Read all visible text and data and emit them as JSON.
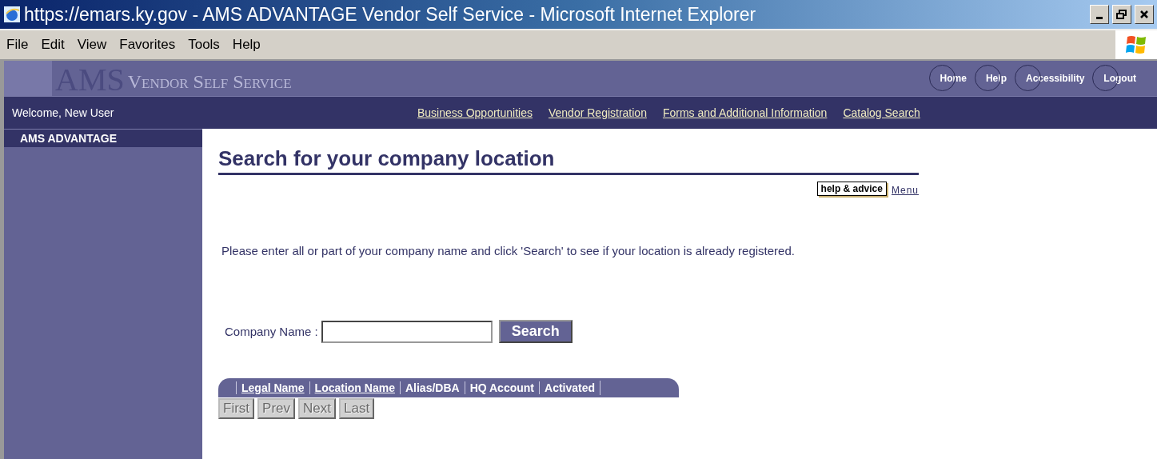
{
  "window": {
    "title": "https://emars.ky.gov - AMS ADVANTAGE Vendor Self Service - Microsoft Internet Explorer"
  },
  "menu": [
    "File",
    "Edit",
    "View",
    "Favorites",
    "Tools",
    "Help"
  ],
  "banner": {
    "logo": "AMS",
    "subtitle": "Vendor Self Service",
    "buttons": [
      "Home",
      "Help",
      "Accessibility",
      "Logout"
    ]
  },
  "nav": {
    "welcome": "Welcome, New User",
    "links": [
      "Business Opportunities",
      "Vendor Registration",
      "Forms and Additional Information",
      "Catalog Search"
    ]
  },
  "sidebar": {
    "title": "AMS ADVANTAGE"
  },
  "page": {
    "heading": "Search for your company location",
    "help_button": "help & advice",
    "menu_link": "Menu",
    "instructions": "Please enter all or part of your company name and click 'Search' to see if your location is already registered.",
    "field": {
      "label": "Company Name :"
    },
    "search_button": "Search",
    "columns": [
      {
        "label": "Legal Name",
        "sortable": true
      },
      {
        "label": "Location Name",
        "sortable": true
      },
      {
        "label": "Alias/DBA",
        "sortable": false
      },
      {
        "label": "HQ Account",
        "sortable": false
      },
      {
        "label": "Activated",
        "sortable": false
      }
    ],
    "pager": [
      {
        "label": "First",
        "disabled": true
      },
      {
        "label": "Prev",
        "disabled": true
      },
      {
        "label": "Next",
        "disabled": true
      },
      {
        "label": "Last",
        "disabled": true
      }
    ]
  }
}
